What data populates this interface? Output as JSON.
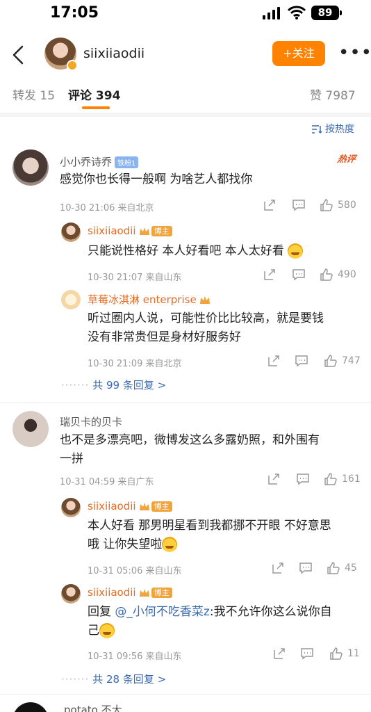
{
  "status_bar": {
    "time": "17:05",
    "battery": "89"
  },
  "header": {
    "username": "siixiiaodii",
    "follow_label": "+关注",
    "more_label": "•••"
  },
  "tabs": [
    {
      "label": "转发 15"
    },
    {
      "label": "评论 394"
    },
    {
      "label": "赞 7987"
    }
  ],
  "sort_label": "按热度",
  "hot_tag": "热评",
  "accent": "#ff8200",
  "comments": [
    {
      "user": "小小乔诗乔",
      "fan_badge": "铁粉1",
      "text": "感觉你也长得一般啊 为啥艺人都找你",
      "meta": "10-30 21:06 来自北京",
      "likes": "580",
      "replies": [
        {
          "user": "siixiiaodii",
          "badge": "博主",
          "text": "只能说性格好 本人好看吧 本人太好看",
          "meta": "10-30 21:07 来自山东",
          "likes": "490"
        },
        {
          "user": "草莓冰淇淋 enterprise",
          "text_line1": "听过圈内人说，可能性价比比较高，就是要钱",
          "text_line2": "没有非常贵但是身材好服务好",
          "meta": "10-30 21:09 来自北京",
          "likes": "747"
        }
      ],
      "more_replies": "共 99 条回复 >"
    },
    {
      "user": "瑞贝卡的贝卡",
      "text_line1": "也不是多漂亮吧，微博发这么多露奶照，和外围有",
      "text_line2": "一拼",
      "meta": "10-31 04:59 来自广东",
      "likes": "161",
      "replies": [
        {
          "user": "siixiiaodii",
          "badge": "博主",
          "text_line1": "本人好看 那男明星看到我都挪不开眼 不好意思",
          "text_line2": "哦 让你失望啦",
          "meta": "10-31 05:06 来自山东",
          "likes": "45"
        },
        {
          "user": "siixiiaodii",
          "badge": "博主",
          "reply_prefix": "回复 ",
          "mention": "@_小何不吃香菜z",
          "text_rest": ":我不允许你这么说你自",
          "text_line2": "己",
          "meta": "10-31 09:56 来自山东",
          "likes": "11"
        }
      ],
      "more_replies": "共 28 条回复 >"
    }
  ],
  "partial_user": "potato 不大"
}
